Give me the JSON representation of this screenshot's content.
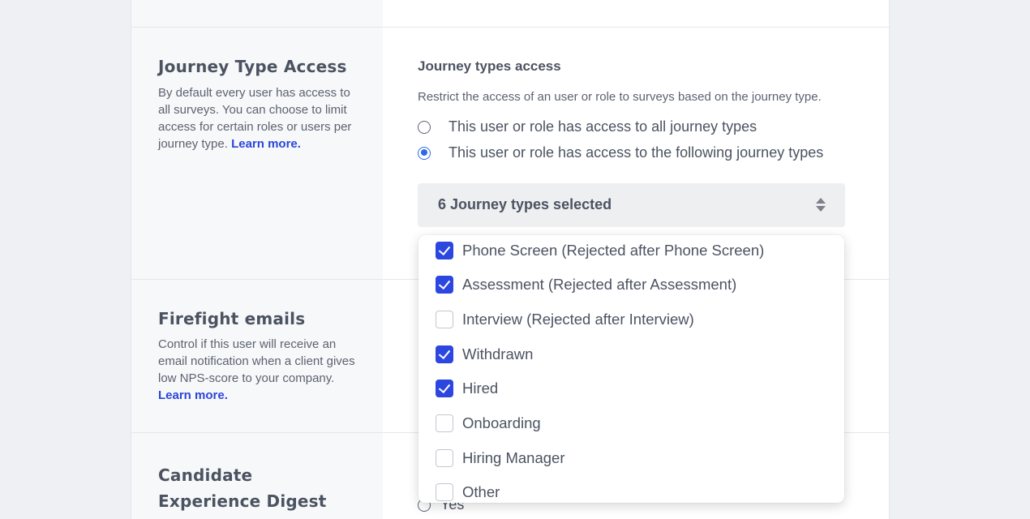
{
  "journey_section": {
    "title": "Journey Type Access",
    "description": "By default every user has access to all surveys. You can choose to limit access for certain roles or users per journey type.",
    "learn_more": "Learn more.",
    "right_title": "Journey types access",
    "right_description": "Restrict the access of an user or role to surveys based on the journey type.",
    "radio_all": {
      "label": "This user or role has access to all journey types",
      "checked": false
    },
    "radio_following": {
      "label": "This user or role has access to the following journey types",
      "checked": true
    },
    "select_label": "6 Journey types selected",
    "options": [
      {
        "label": "Phone Screen (Rejected after Phone Screen)",
        "checked": true
      },
      {
        "label": "Assessment (Rejected after Assessment)",
        "checked": true
      },
      {
        "label": "Interview (Rejected after Interview)",
        "checked": false
      },
      {
        "label": "Withdrawn",
        "checked": true
      },
      {
        "label": "Hired",
        "checked": true
      },
      {
        "label": "Onboarding",
        "checked": false
      },
      {
        "label": "Hiring Manager",
        "checked": false
      },
      {
        "label": "Other",
        "checked": false
      }
    ]
  },
  "firefight_section": {
    "title": "Firefight emails",
    "description": "Control if this user will receive an email notification when a client gives low NPS-score to your company.",
    "learn_more": "Learn more."
  },
  "digest_section": {
    "title_line1": "Candidate",
    "title_line2": "Experience Digest",
    "yes_label": "Yes"
  },
  "colors": {
    "accent": "#2b47e0",
    "radio_accent": "#2f6be6",
    "link": "#2a46d8"
  }
}
